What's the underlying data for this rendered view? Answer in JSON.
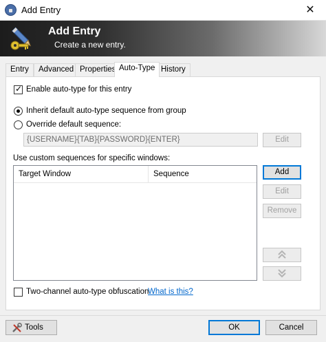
{
  "window": {
    "title": "Add Entry",
    "close_glyph": "✕"
  },
  "banner": {
    "title": "Add Entry",
    "subtitle": "Create a new entry."
  },
  "tabs": [
    {
      "label": "Entry"
    },
    {
      "label": "Advanced"
    },
    {
      "label": "Properties"
    },
    {
      "label": "Auto-Type",
      "active": true
    },
    {
      "label": "History"
    }
  ],
  "autotype": {
    "enable_label": "Enable auto-type for this entry",
    "enable_checked": true,
    "inherit_label": "Inherit default auto-type sequence from group",
    "inherit_selected": true,
    "override_label": "Override default sequence:",
    "sequence_value": "{USERNAME}{TAB}{PASSWORD}{ENTER}",
    "edit_label": "Edit",
    "custom_label": "Use custom sequences for specific windows:",
    "columns": [
      "Target Window",
      "Sequence"
    ],
    "add_label": "Add",
    "list_edit_label": "Edit",
    "remove_label": "Remove",
    "two_channel_label": "Two-channel auto-type obfuscation",
    "two_channel_checked": false,
    "what_is_this": "What is this?"
  },
  "footer": {
    "tools_label": "Tools",
    "ok_label": "OK",
    "cancel_label": "Cancel"
  },
  "icons": {
    "app": "lock-icon",
    "banner": "key-pencil-icon",
    "move_up": "double-chevron-up-icon",
    "move_down": "double-chevron-down-icon",
    "tools": "tools-icon"
  },
  "colors": {
    "link": "#0066cc",
    "accent_default_button": "#0078d7"
  }
}
